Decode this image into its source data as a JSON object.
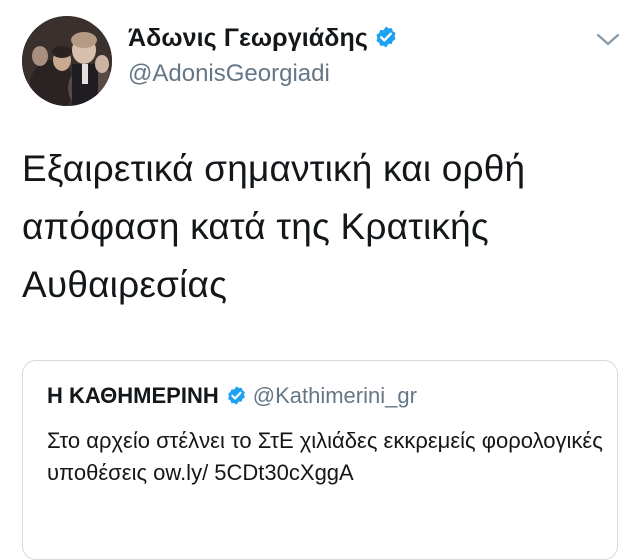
{
  "tweet": {
    "author_name": "Άδωνις Γεωργιάδης",
    "author_handle": "@AdonisGeorgiadi",
    "text": "Εξαιρετικά σημαντική και ορθή απόφαση κατά της Κρατικής Αυθαιρεσίας",
    "verified": true,
    "menu_icon": "chevron-down-icon"
  },
  "quoted_tweet": {
    "author_name": "Η ΚΑΘΗΜΕΡΙΝΗ",
    "author_handle": "@Kathimerini_gr",
    "verified": true,
    "text": "Στο αρχείο στέλνει το ΣτΕ χιλιάδες εκκρεμείς φορολογικές υποθέσεις ow.ly/ 5CDt30cXggA"
  },
  "colors": {
    "text": "#14171a",
    "secondary": "#657786",
    "verified_blue": "#1da1f2",
    "border": "#d4dbe1"
  }
}
